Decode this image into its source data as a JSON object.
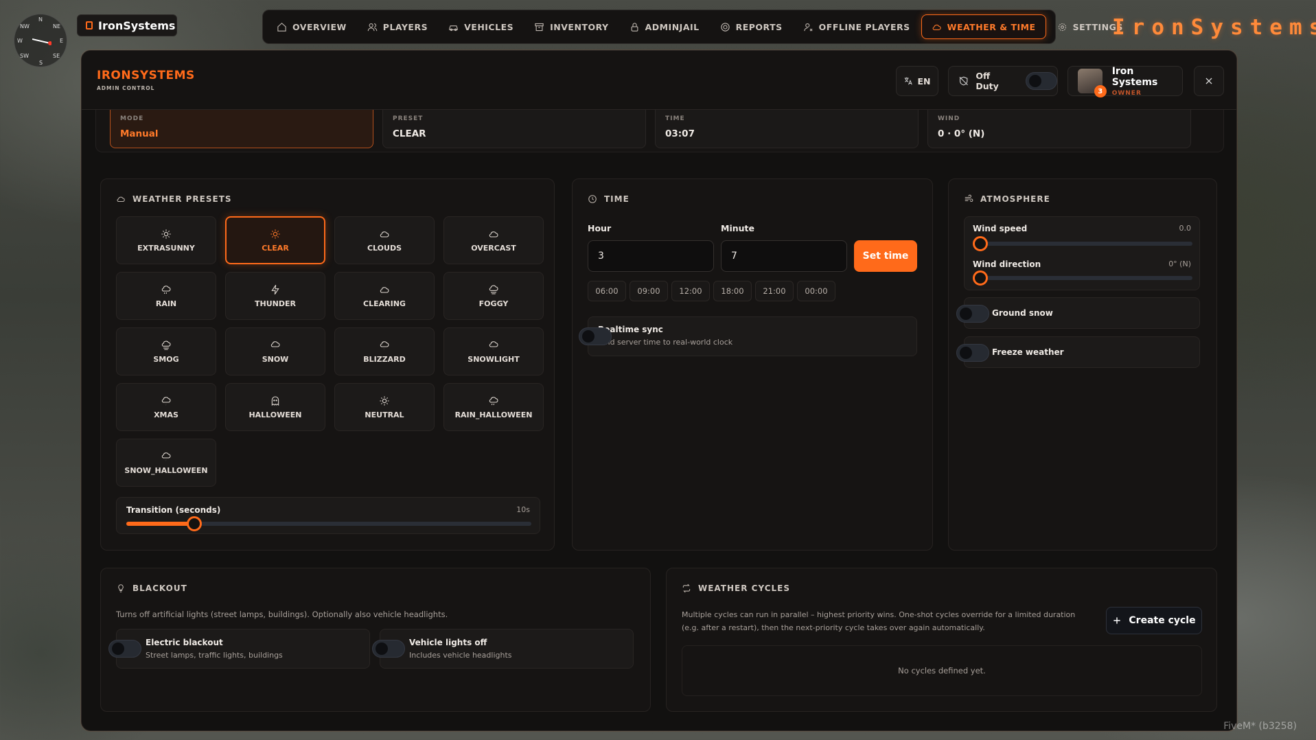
{
  "brand": {
    "chip_label": "IronSystems",
    "logo_text": "IronSystems"
  },
  "compass": {
    "n": "N",
    "ne": "NE",
    "nw": "NW",
    "w": "W",
    "e": "E",
    "sw": "SW",
    "se": "SE",
    "s": "S"
  },
  "nav": {
    "items": [
      {
        "label": "OVERVIEW",
        "icon": "home-icon"
      },
      {
        "label": "PLAYERS",
        "icon": "users-icon"
      },
      {
        "label": "VEHICLES",
        "icon": "car-icon"
      },
      {
        "label": "INVENTORY",
        "icon": "archive-icon"
      },
      {
        "label": "ADMINJAIL",
        "icon": "lock-icon"
      },
      {
        "label": "REPORTS",
        "icon": "lifebuoy-icon"
      },
      {
        "label": "OFFLINE PLAYERS",
        "icon": "user-off-icon"
      },
      {
        "label": "WEATHER & TIME",
        "icon": "cloud-icon",
        "active": true
      },
      {
        "label": "SETTINGS",
        "icon": "gear-icon"
      }
    ]
  },
  "header": {
    "title": "IRONSYSTEMS",
    "subtitle": "ADMIN CONTROL",
    "language": "EN",
    "duty_label": "Off Duty",
    "user": {
      "name": "Iron Systems",
      "role": "OWNER",
      "badge": "3"
    }
  },
  "status": {
    "mode": {
      "label": "MODE",
      "value": "Manual"
    },
    "preset": {
      "label": "PRESET",
      "value": "CLEAR"
    },
    "time": {
      "label": "TIME",
      "value": "03:07"
    },
    "wind": {
      "label": "WIND",
      "value": "0 · 0° (N)"
    }
  },
  "presets": {
    "title": "WEATHER PRESETS",
    "items": [
      {
        "label": "EXTRASUNNY",
        "icon": "sun-icon"
      },
      {
        "label": "CLEAR",
        "icon": "sun-icon",
        "active": true
      },
      {
        "label": "CLOUDS",
        "icon": "cloud-icon"
      },
      {
        "label": "OVERCAST",
        "icon": "cloud-icon"
      },
      {
        "label": "RAIN",
        "icon": "cloud-rain-icon"
      },
      {
        "label": "THUNDER",
        "icon": "lightning-icon"
      },
      {
        "label": "CLEARING",
        "icon": "cloud-icon"
      },
      {
        "label": "FOGGY",
        "icon": "cloud-fog-icon"
      },
      {
        "label": "SMOG",
        "icon": "cloud-fog-icon"
      },
      {
        "label": "SNOW",
        "icon": "cloud-snow-icon"
      },
      {
        "label": "BLIZZARD",
        "icon": "cloud-snow-icon"
      },
      {
        "label": "SNOWLIGHT",
        "icon": "cloud-snow-icon"
      },
      {
        "label": "XMAS",
        "icon": "cloud-snow-icon"
      },
      {
        "label": "HALLOWEEN",
        "icon": "ghost-icon"
      },
      {
        "label": "NEUTRAL",
        "icon": "sun-icon"
      },
      {
        "label": "RAIN_HALLOWEEN",
        "icon": "cloud-rain-icon"
      },
      {
        "label": "SNOW_HALLOWEEN",
        "icon": "cloud-snow-icon"
      }
    ],
    "transition_label": "Transition (seconds)",
    "transition_value": "10s",
    "transition_fraction": 0.1
  },
  "time_card": {
    "title": "TIME",
    "hour_label": "Hour",
    "minute_label": "Minute",
    "hour_value": "3",
    "minute_value": "7",
    "set_label": "Set time",
    "quick": [
      "06:00",
      "09:00",
      "12:00",
      "18:00",
      "21:00",
      "00:00"
    ],
    "sync_title": "Realtime sync",
    "sync_desc": "Bind server time to real-world clock"
  },
  "atmosphere": {
    "title": "ATMOSPHERE",
    "wind_speed_label": "Wind speed",
    "wind_speed_value": "0.0",
    "wind_dir_label": "Wind direction",
    "wind_dir_value": "0° (N)",
    "ground_snow": "Ground snow",
    "freeze_weather": "Freeze weather"
  },
  "blackout": {
    "title": "BLACKOUT",
    "desc": "Turns off artificial lights (street lamps, buildings). Optionally also vehicle headlights.",
    "electric_title": "Electric blackout",
    "electric_desc": "Street lamps, traffic lights, buildings",
    "vehicle_title": "Vehicle lights off",
    "vehicle_desc": "Includes vehicle headlights"
  },
  "cycles": {
    "title": "WEATHER CYCLES",
    "desc": "Multiple cycles can run in parallel – highest priority wins. One-shot cycles override for a limited duration (e.g. after a restart), then the next-priority cycle takes over again automatically.",
    "create_label": "Create cycle",
    "empty": "No cycles defined yet."
  },
  "footer": {
    "fivem": "FiveM* (b3258)"
  },
  "colors": {
    "accent": "#ff6a1a",
    "panel": "#121110",
    "card": "#161413"
  }
}
